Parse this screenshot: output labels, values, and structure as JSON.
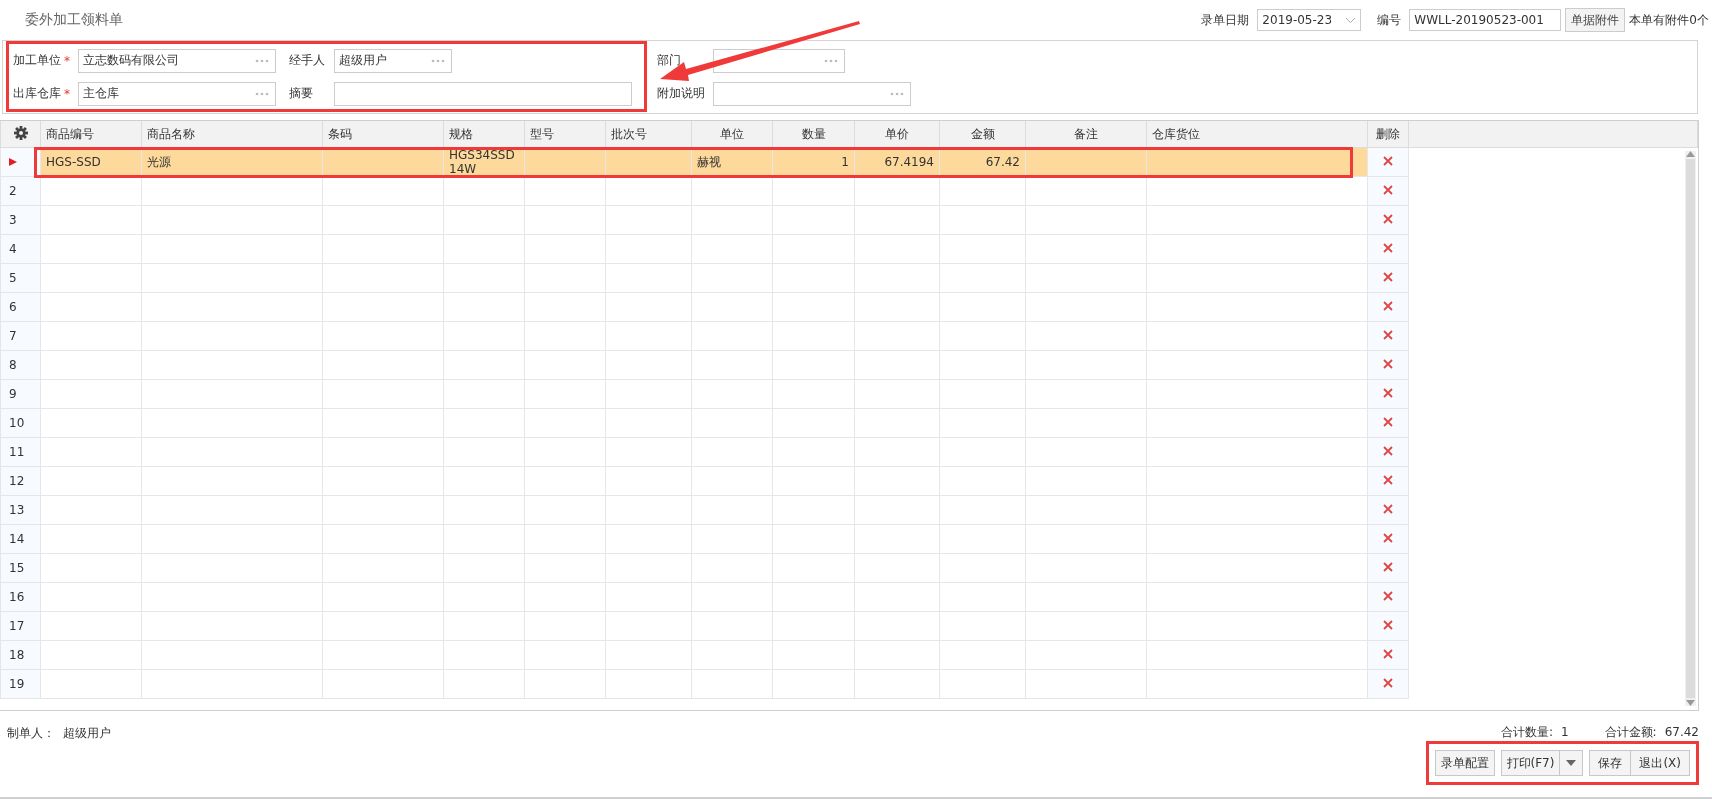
{
  "header": {
    "title": "委外加工领料单",
    "date": {
      "label": "录单日期",
      "value": "2019-05-23"
    },
    "number": {
      "label": "编号",
      "value": "WWLL-20190523-001"
    },
    "attach_button": "单据附件",
    "attach_note": "本单有附件0个"
  },
  "form": {
    "highlighted": true,
    "fields": [
      {
        "label": "加工单位",
        "required_mark": "*",
        "value": "立志数码有限公司",
        "kind": "lookup"
      },
      {
        "label": "经手人",
        "value": "超级用户",
        "kind": "lookup"
      },
      {
        "label": "部门",
        "kind": "lookup"
      },
      {
        "label": "出库仓库",
        "required_mark": "*",
        "value": "主仓库",
        "kind": "lookup"
      },
      {
        "label": "摘要",
        "kind": "text"
      },
      {
        "label": "附加说明",
        "kind": "lookup"
      }
    ]
  },
  "arrow": true,
  "grid": {
    "delete_label": "删除",
    "columns": [
      {
        "label": "商品编号"
      },
      {
        "label": "商品名称"
      },
      {
        "label": "条码"
      },
      {
        "label": "规格"
      },
      {
        "label": "型号"
      },
      {
        "label": "批次号"
      },
      {
        "label": "单位"
      },
      {
        "label": "数量"
      },
      {
        "label": "单价"
      },
      {
        "label": "金额"
      },
      {
        "label": "备注"
      },
      {
        "label": "仓库货位"
      }
    ],
    "rows": [
      {
        "current": true,
        "selected": true,
        "highlighted": true,
        "cells": [
          "HGS-SSD",
          "光源",
          null,
          "HGS34SSD14W",
          null,
          null,
          "赫视",
          "1",
          "67.4194",
          "67.42",
          null,
          null
        ]
      },
      {
        "number": "2",
        "selected": false
      },
      {
        "number": "3",
        "selected": false
      },
      {
        "number": "4",
        "selected": false
      },
      {
        "number": "5",
        "selected": false
      },
      {
        "number": "6",
        "selected": false
      },
      {
        "number": "7",
        "selected": false
      },
      {
        "number": "8",
        "selected": false
      },
      {
        "number": "9",
        "selected": false
      },
      {
        "number": "10",
        "selected": false
      },
      {
        "number": "11",
        "selected": false
      },
      {
        "number": "12",
        "selected": false
      },
      {
        "number": "13",
        "selected": false
      },
      {
        "number": "14",
        "selected": false
      },
      {
        "number": "15",
        "selected": false
      },
      {
        "number": "16",
        "selected": false
      },
      {
        "number": "17",
        "selected": false
      },
      {
        "number": "18",
        "selected": false
      },
      {
        "number": "19",
        "selected": false
      }
    ]
  },
  "footer": {
    "creator": {
      "label": "制单人：",
      "value": "超级用户"
    },
    "totals": [
      {
        "label": "合计数量:",
        "value": "1"
      },
      {
        "label": "合计金额:",
        "value": "67.42"
      }
    ],
    "highlighted": true,
    "buttons": [
      {
        "label": "录单配置",
        "kind": "plain"
      },
      {
        "label": "打印(F7)",
        "kind": "split"
      },
      {
        "label": "保存",
        "kind": "joined"
      },
      {
        "label": "退出(X)",
        "kind": "joined"
      }
    ]
  }
}
